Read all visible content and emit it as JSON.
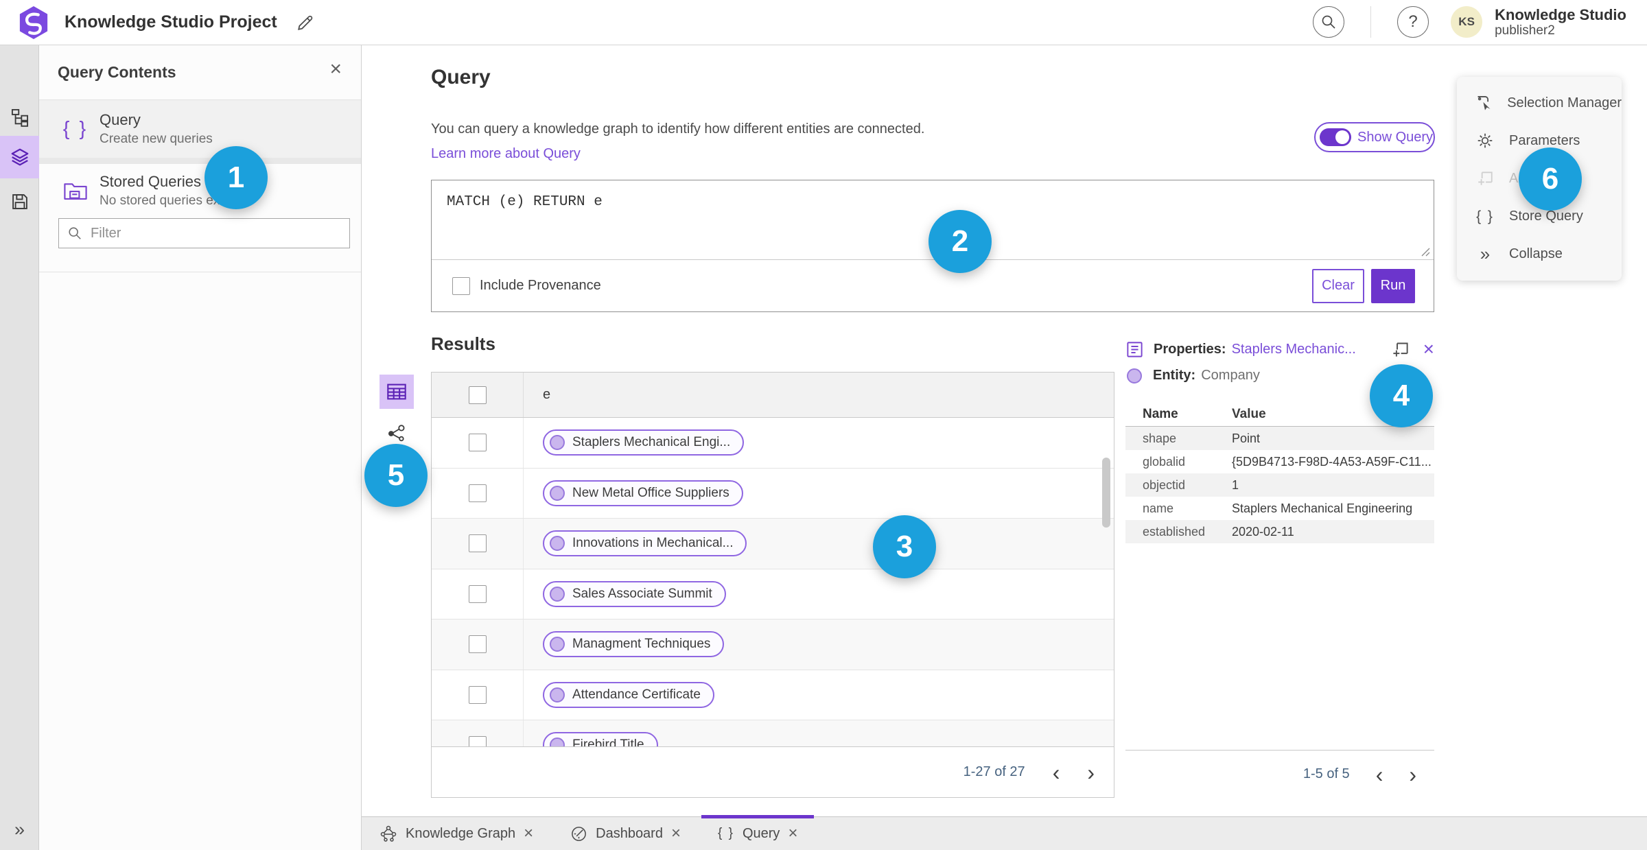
{
  "colors": {
    "accent": "#6c35cc",
    "accent_light": "#7a4ed8",
    "callout": "#1ba0dc",
    "pill_border": "#8f66e2",
    "pill_circle": "#cab6ee",
    "pill_circle_border": "#9878dd",
    "icon_purple": "#7a45d0",
    "active_icon_bg": "#d9c3f7",
    "avatar_bg": "#f2edc9",
    "pagination_text": "#46627f"
  },
  "glyphs": {
    "close": "×",
    "chevron_left": "‹",
    "chevron_right": "›",
    "braces": "{ }",
    "collapse": "»",
    "expand": "»",
    "help": "?"
  },
  "topbar": {
    "title": "Knowledge Studio Project",
    "user_org": "Knowledge Studio",
    "user_name": "publisher2",
    "avatar_initials": "KS"
  },
  "contents_panel": {
    "title": "Query Contents",
    "query_item": {
      "title": "Query",
      "subtitle": "Create new queries"
    },
    "stored_item": {
      "title": "Stored Queries",
      "subtitle": "No stored queries exist"
    },
    "filter_placeholder": "Filter"
  },
  "query_section": {
    "heading": "Query",
    "description": "You can query a knowledge graph to identify how different entities are connected.",
    "link": "Learn more about Query",
    "toggle_label": "Show Query",
    "query_text": "MATCH (e) RETURN e",
    "provenance_label": "Include Provenance",
    "clear_label": "Clear",
    "run_label": "Run"
  },
  "results": {
    "heading": "Results",
    "column_header": "e",
    "rows": [
      "Staplers Mechanical Engi...",
      "New Metal Office Suppliers",
      "Innovations in Mechanical...",
      "Sales Associate Summit",
      "Managment Techniques",
      "Attendance Certificate",
      "Firebird Title"
    ],
    "pagination": "1-27 of 27"
  },
  "properties_panel": {
    "title_label": "Properties:",
    "title_link": "Staplers Mechanic...",
    "entity_label": "Entity:",
    "entity_value": "Company",
    "col_name": "Name",
    "col_value": "Value",
    "rows": [
      {
        "name": "shape",
        "value": "Point"
      },
      {
        "name": "globalid",
        "value": "{5D9B4713-F98D-4A53-A59F-C11..."
      },
      {
        "name": "objectid",
        "value": "1"
      },
      {
        "name": "name",
        "value": "Staplers Mechanical Engineering"
      },
      {
        "name": "established",
        "value": "2020-02-11"
      }
    ],
    "pagination": "1-5 of 5"
  },
  "right_menu": {
    "items": [
      "Selection Manager",
      "Parameters",
      "Add",
      "Store Query",
      "Collapse"
    ]
  },
  "tabs": [
    {
      "label": "Knowledge Graph"
    },
    {
      "label": "Dashboard"
    },
    {
      "label": "Query"
    }
  ],
  "badges": [
    "1",
    "2",
    "3",
    "4",
    "5",
    "6"
  ]
}
